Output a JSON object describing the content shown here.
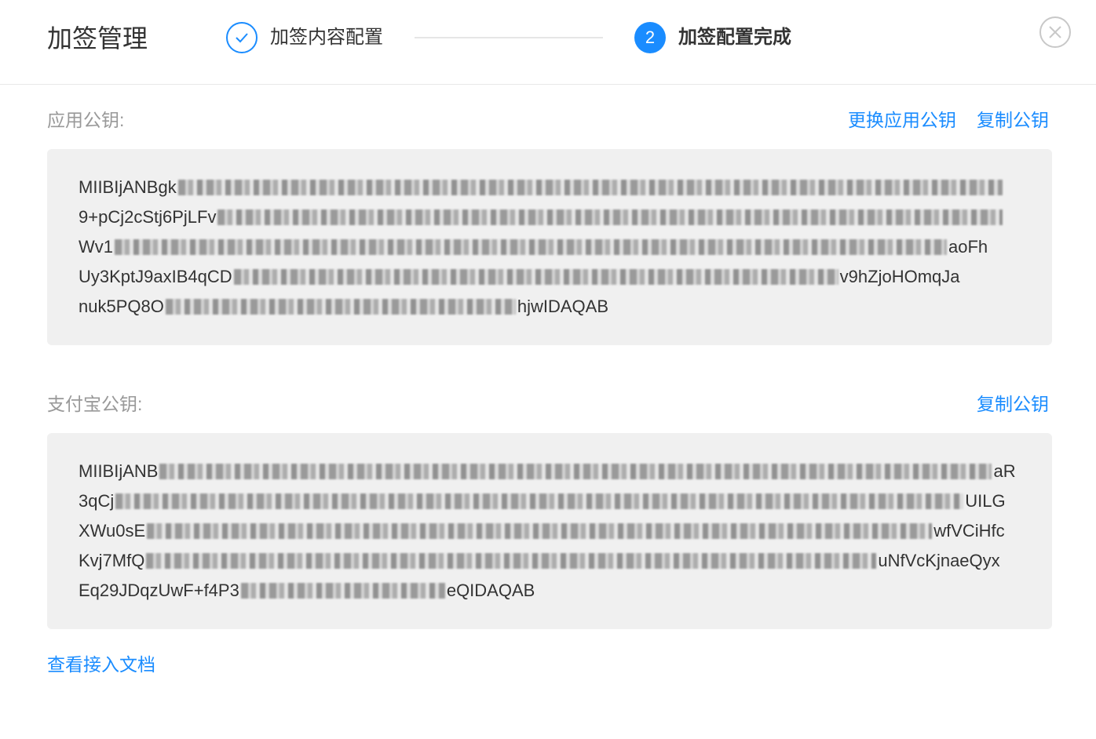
{
  "header": {
    "title": "加签管理",
    "step1_label": "加签内容配置",
    "step2_number": "2",
    "step2_label": "加签配置完成"
  },
  "app_key": {
    "label": "应用公钥:",
    "change_link": "更换应用公钥",
    "copy_link": "复制公钥",
    "lines": [
      {
        "start": "MIIBIjANBgk",
        "end": ""
      },
      {
        "start": "9+pCj2cStj6PjLFv",
        "end": ""
      },
      {
        "start": "Wv1",
        "end": "aoFh"
      },
      {
        "start": "Uy3KptJ9axIB4qCD",
        "end": "v9hZjoHOmqJa"
      },
      {
        "start": "nuk5PQ8O",
        "end": "hjwIDAQAB"
      }
    ]
  },
  "alipay_key": {
    "label": "支付宝公钥:",
    "copy_link": "复制公钥",
    "lines": [
      {
        "start": "MIIBIjANB",
        "end": "aR"
      },
      {
        "start": "3qCj",
        "end": "UILG"
      },
      {
        "start": "XWu0sE",
        "end": "wfVCiHfc"
      },
      {
        "start": "Kvj7MfQ",
        "end": "uNfVcKjnaeQyx"
      },
      {
        "start": "Eq29JDqzUwF+f4P3",
        "end": "eQIDAQAB"
      }
    ]
  },
  "docs_link": "查看接入文档",
  "colors": {
    "accent": "#1a8cff",
    "box_bg": "#f0f0f0",
    "label": "#999999"
  }
}
